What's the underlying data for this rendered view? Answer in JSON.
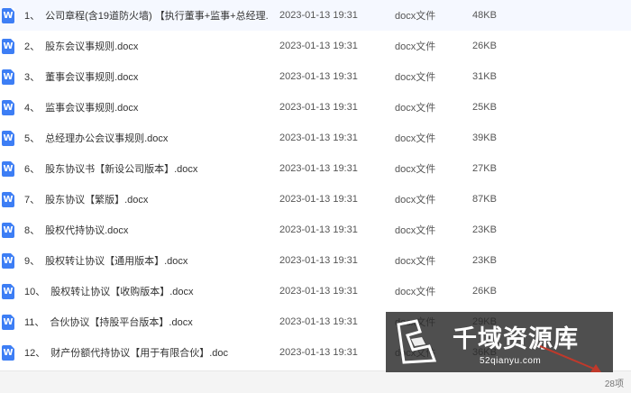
{
  "files": [
    {
      "index": "1、",
      "name": "公司章程(含19道防火墙) 【执行董事+监事+总经理...",
      "modified": "2023-01-13 19:31",
      "type": "docx文件",
      "size": "48KB"
    },
    {
      "index": "2、",
      "name": "股东会议事规则.docx",
      "modified": "2023-01-13 19:31",
      "type": "docx文件",
      "size": "26KB"
    },
    {
      "index": "3、",
      "name": "董事会议事规则.docx",
      "modified": "2023-01-13 19:31",
      "type": "docx文件",
      "size": "31KB"
    },
    {
      "index": "4、",
      "name": "监事会议事规则.docx",
      "modified": "2023-01-13 19:31",
      "type": "docx文件",
      "size": "25KB"
    },
    {
      "index": "5、",
      "name": "总经理办公会议事规则.docx",
      "modified": "2023-01-13 19:31",
      "type": "docx文件",
      "size": "39KB"
    },
    {
      "index": "6、",
      "name": "股东协议书【新设公司版本】.docx",
      "modified": "2023-01-13 19:31",
      "type": "docx文件",
      "size": "27KB"
    },
    {
      "index": "7、",
      "name": "股东协议【繁版】.docx",
      "modified": "2023-01-13 19:31",
      "type": "docx文件",
      "size": "87KB"
    },
    {
      "index": "8、",
      "name": "股权代持协议.docx",
      "modified": "2023-01-13 19:31",
      "type": "docx文件",
      "size": "23KB"
    },
    {
      "index": "9、",
      "name": "股权转让协议【通用版本】.docx",
      "modified": "2023-01-13 19:31",
      "type": "docx文件",
      "size": "23KB"
    },
    {
      "index": "10、",
      "name": "股权转让协议【收购版本】.docx",
      "modified": "2023-01-13 19:31",
      "type": "docx文件",
      "size": "26KB"
    },
    {
      "index": "11、",
      "name": "合伙协议【持股平台版本】.docx",
      "modified": "2023-01-13 19:31",
      "type": "docx文件",
      "size": "29KB"
    },
    {
      "index": "12、",
      "name": "财产份额代持协议【用于有限合伙】.doc",
      "modified": "2023-01-13 19:31",
      "type": "docx文件",
      "size": "36KB"
    }
  ],
  "icon": {
    "name": "word-doc-icon",
    "letter": "W",
    "color": "#3d7ef5"
  },
  "footer": {
    "item_count": "28项"
  },
  "watermark": {
    "title": "千域资源库",
    "url": "52qianyu.com"
  }
}
